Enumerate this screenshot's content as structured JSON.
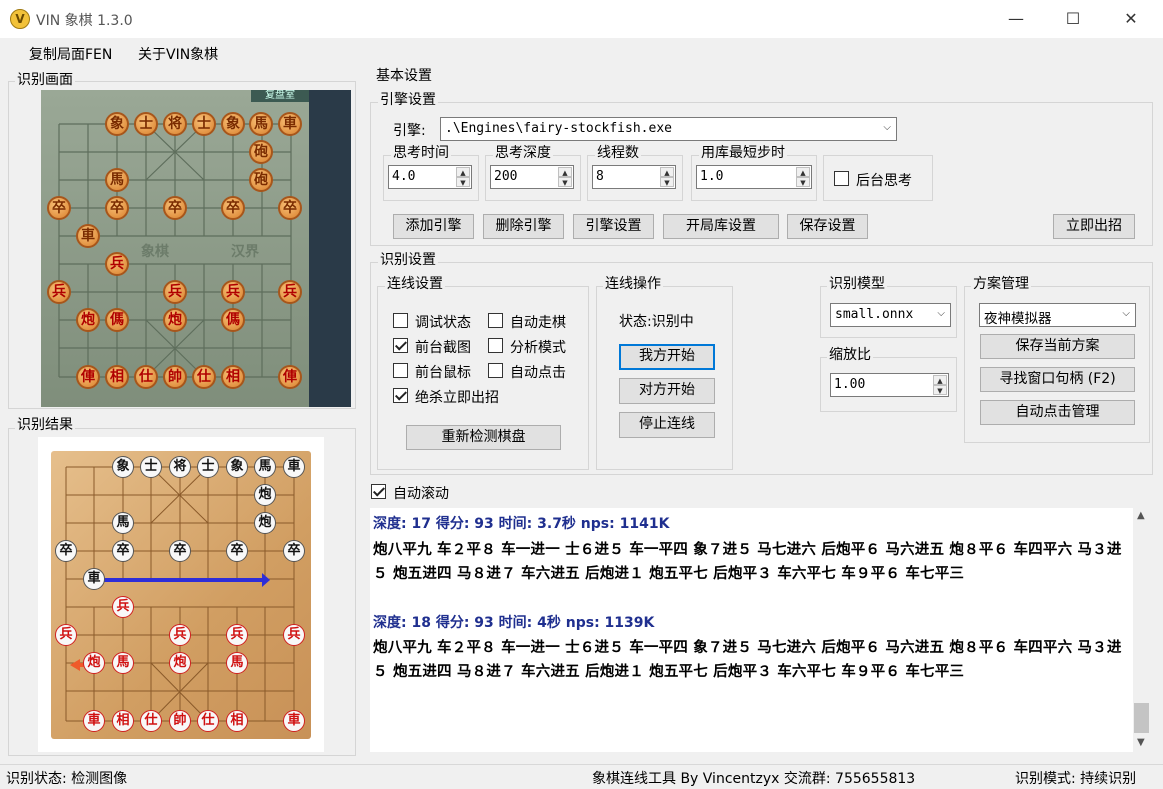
{
  "window": {
    "title": "VIN 象棋 1.3.0",
    "icon": "V"
  },
  "menu": [
    "复制局面FEN",
    "关于VIN象棋"
  ],
  "left": {
    "capture_label": "识别画面",
    "result_label": "识别结果"
  },
  "basic": {
    "label": "基本设置"
  },
  "engine": {
    "group_label": "引擎设置",
    "engine_label": "引擎:",
    "engine_path": ".\\Engines\\fairy-stockfish.exe",
    "think_time": {
      "label": "思考时间",
      "value": "4.0"
    },
    "think_depth": {
      "label": "思考深度",
      "value": "200"
    },
    "threads": {
      "label": "线程数",
      "value": "8"
    },
    "book_min": {
      "label": "用库最短步时",
      "value": "1.0"
    },
    "bg_think": {
      "label": "后台思考",
      "checked": false
    },
    "buttons": [
      "添加引擎",
      "删除引擎",
      "引擎设置",
      "开局库设置",
      "保存设置"
    ],
    "move_now": "立即出招"
  },
  "recog": {
    "group_label": "识别设置",
    "conn": {
      "label": "连线设置",
      "checks": [
        {
          "label": "调试状态",
          "checked": false
        },
        {
          "label": "自动走棋",
          "checked": false
        },
        {
          "label": "前台截图",
          "checked": true
        },
        {
          "label": "分析模式",
          "checked": false
        },
        {
          "label": "前台鼠标",
          "checked": false
        },
        {
          "label": "自动点击",
          "checked": false
        },
        {
          "label": "绝杀立即出招",
          "checked": true
        }
      ],
      "redetect": "重新检测棋盘"
    },
    "ops": {
      "label": "连线操作",
      "status": "状态:识别中",
      "my_start": "我方开始",
      "opp_start": "对方开始",
      "stop": "停止连线"
    },
    "model": {
      "label": "识别模型",
      "value": "small.onnx"
    },
    "scale": {
      "label": "缩放比",
      "value": "1.00"
    },
    "scheme": {
      "label": "方案管理",
      "value": "夜神模拟器",
      "save": "保存当前方案",
      "find": "寻找窗口句柄 (F2)",
      "auto_click": "自动点击管理"
    }
  },
  "auto_scroll": {
    "label": "自动滚动",
    "checked": true
  },
  "log": [
    {
      "head": "深度: 17 得分: 93 时间: 3.7秒 nps: 1141K",
      "lines": [
        "炮八平九 车２平８ 车一进一 士６进５ 车一平四 象７进５ 马七进六 后炮平６ 马六进五 炮８平６ 车四平六 马３进",
        "５ 炮五进四 马８进７ 车六进五 后炮进１ 炮五平七 后炮平３ 车六平七 车９平６ 车七平三"
      ]
    },
    {
      "head": "深度: 18 得分: 93 时间: 4秒 nps: 1139K",
      "lines": [
        "炮八平九 车２平８ 车一进一 士６进５ 车一平四 象７进５ 马七进六 后炮平６ 马六进五 炮８平６ 车四平六 马３进",
        "５ 炮五进四 马８进７ 车六进五 后炮进１ 炮五平七 后炮平３ 车六平七 车９平６ 车七平三"
      ]
    }
  ],
  "status": {
    "left": "识别状态: 检测图像",
    "center": "象棋连线工具 By Vincentzyx 交流群: 755655813",
    "right": "识别模式: 持续识别"
  },
  "capture_pieces": {
    "top_bar": "复盘室",
    "river_left": "象棋",
    "river_right": "汉界",
    "pieces": [
      "象",
      "士",
      "将",
      "士",
      "象",
      "馬",
      "車",
      "砲",
      "馬",
      "砲",
      "卒",
      "卒",
      "卒",
      "卒",
      "卒",
      "車",
      "兵",
      "兵",
      "兵",
      "兵",
      "兵",
      "炮",
      "傌",
      "炮",
      "傌",
      "俥",
      "相",
      "仕",
      "帥",
      "仕",
      "相",
      "俥"
    ]
  },
  "result_pieces": [
    "象",
    "士",
    "将",
    "士",
    "象",
    "馬",
    "車",
    "炮",
    "馬",
    "炮",
    "卒",
    "卒",
    "卒",
    "卒",
    "卒",
    "車",
    "兵",
    "兵",
    "兵",
    "兵",
    "兵",
    "炮",
    "馬",
    "炮",
    "馬",
    "車",
    "相",
    "仕",
    "帥",
    "仕",
    "相",
    "車"
  ]
}
